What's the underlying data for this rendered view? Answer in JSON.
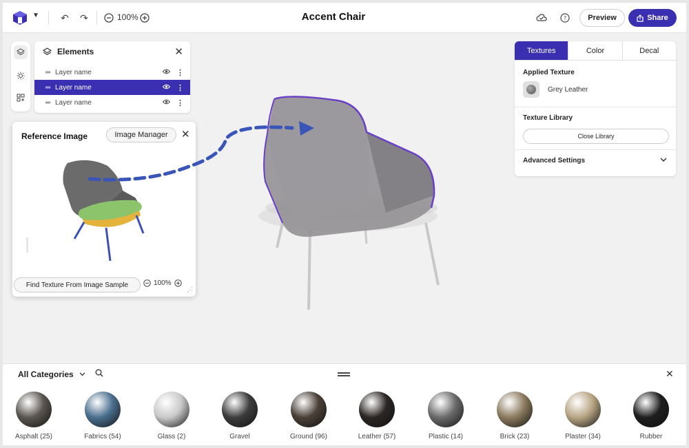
{
  "topbar": {
    "zoom": "100%",
    "title": "Accent Chair",
    "preview_label": "Preview",
    "share_label": "Share"
  },
  "elements_panel": {
    "title": "Elements",
    "layers": [
      {
        "name": "Layer name",
        "selected": false
      },
      {
        "name": "Layer name",
        "selected": true
      },
      {
        "name": "Layer name",
        "selected": false
      }
    ]
  },
  "reference_panel": {
    "title": "Reference Image",
    "image_manager_label": "Image Manager",
    "find_texture_label": "Find Texture From Image Sample",
    "zoom": "100%"
  },
  "right_panel": {
    "tabs": [
      "Textures",
      "Color",
      "Decal"
    ],
    "active_tab": "Textures",
    "applied_texture_label": "Applied Texture",
    "applied_texture_value": "Grey Leather",
    "texture_library_label": "Texture Library",
    "close_library_label": "Close Library",
    "advanced_settings_label": "Advanced Settings"
  },
  "library": {
    "category_label": "All Categories",
    "materials": [
      {
        "label": "Asphalt (25)",
        "color": "#5a554f"
      },
      {
        "label": "Fabrics (54)",
        "color": "#4a6f8e"
      },
      {
        "label": "Glass (2)",
        "color": "#c9c9c9"
      },
      {
        "label": "Gravel",
        "color": "#3c3c3c"
      },
      {
        "label": "Ground (96)",
        "color": "#4a4038"
      },
      {
        "label": "Leather (57)",
        "color": "#2b2624"
      },
      {
        "label": "Plastic (14)",
        "color": "#6a6a6a"
      },
      {
        "label": "Brick (23)",
        "color": "#8b7a5e"
      },
      {
        "label": "Plaster (34)",
        "color": "#b8a584"
      },
      {
        "label": "Rubber",
        "color": "#1e1e1e"
      }
    ]
  },
  "colors": {
    "accent": "#3a2fb0",
    "arrow": "#3a55b8",
    "selection_outline": "#6a3fc8"
  }
}
